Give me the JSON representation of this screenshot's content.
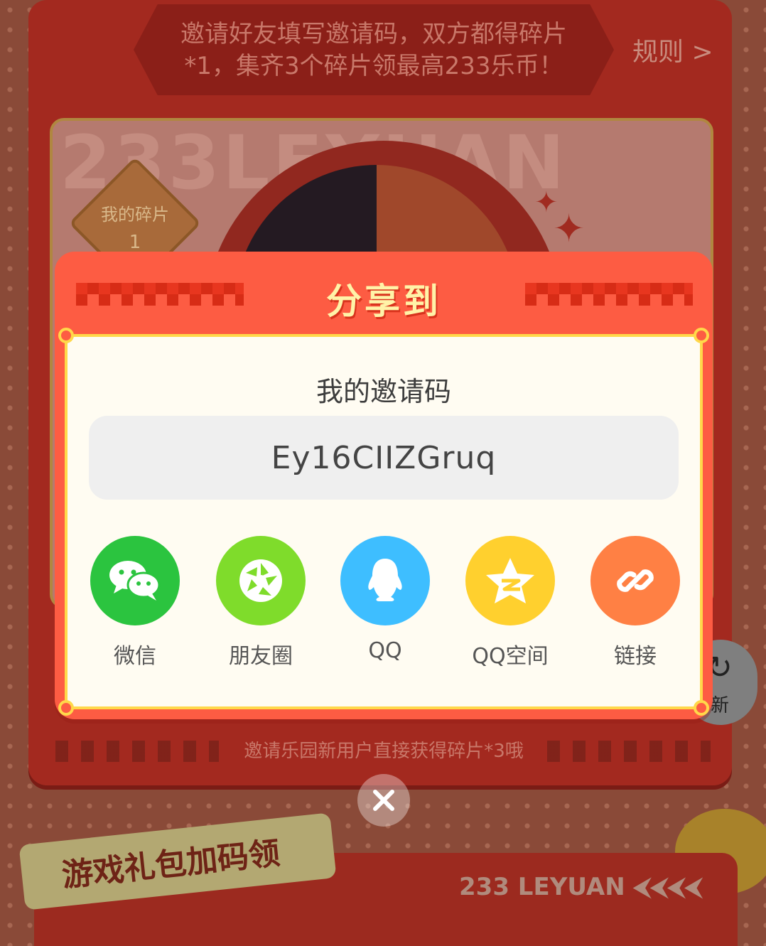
{
  "background": {
    "banner_line1": "邀请好友填写邀请码，双方都得碎片",
    "banner_line2": "*1，集齐3个碎片领最高233乐币！",
    "rules_link": "规则 >",
    "watermark": "233LEYUAN",
    "my_fragments_label": "我的碎片",
    "my_fragments_count": "1",
    "invite_note": "邀请乐园新用户直接获得碎片*3哦",
    "refresh_label": "新",
    "section_title": "游戏礼包加码领",
    "section_brand": "233 LEYUAN"
  },
  "modal": {
    "title": "分享到",
    "invite_code_label": "我的邀请码",
    "invite_code": "Ey16CIIZGruq",
    "share_targets": [
      {
        "label": "微信",
        "icon": "wechat-icon",
        "color": "#2bc43f"
      },
      {
        "label": "朋友圈",
        "icon": "moments-icon",
        "color": "#7fdc2b"
      },
      {
        "label": "QQ",
        "icon": "qq-icon",
        "color": "#3ebeff"
      },
      {
        "label": "QQ空间",
        "icon": "qzone-icon",
        "color": "#ffd02e"
      },
      {
        "label": "链接",
        "icon": "link-icon",
        "color": "#ff8044"
      }
    ],
    "close_icon": "close-icon"
  },
  "colors": {
    "modal_red": "#fd5c43",
    "panel_border": "#ffd84a",
    "title_text": "#fff3a8"
  }
}
